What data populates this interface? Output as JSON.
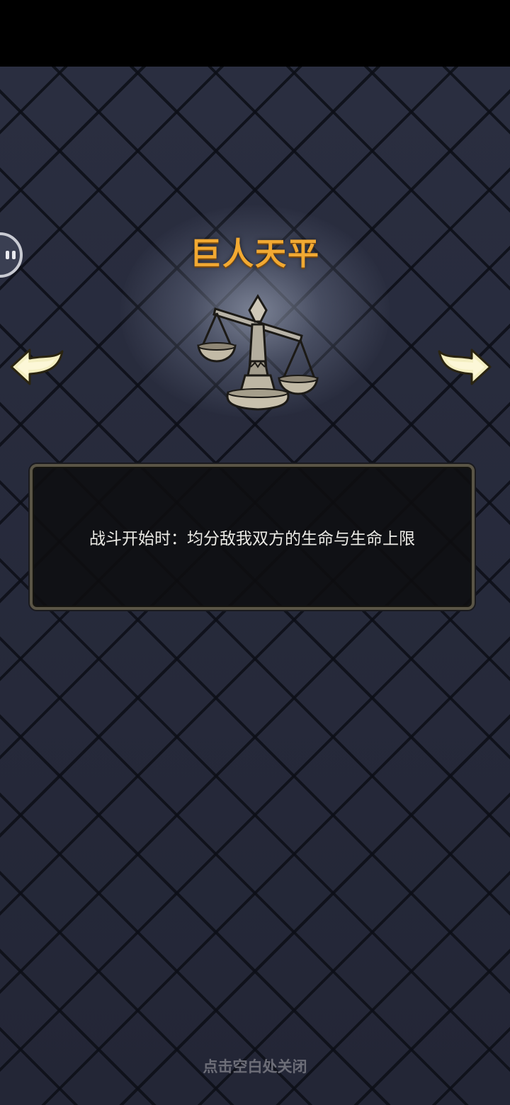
{
  "relic": {
    "name": "巨人天平",
    "description": "战斗开始时：均分敌我双方的生命与生命上限",
    "icon": "balance-scale-icon"
  },
  "navigation": {
    "prev_icon": "arrow-left-icon",
    "next_icon": "arrow-right-icon"
  },
  "footer": {
    "close_hint": "点击空白处关闭"
  },
  "colors": {
    "title": "#f2a932",
    "background": "#262a3b",
    "panel_border": "#5a5546"
  }
}
